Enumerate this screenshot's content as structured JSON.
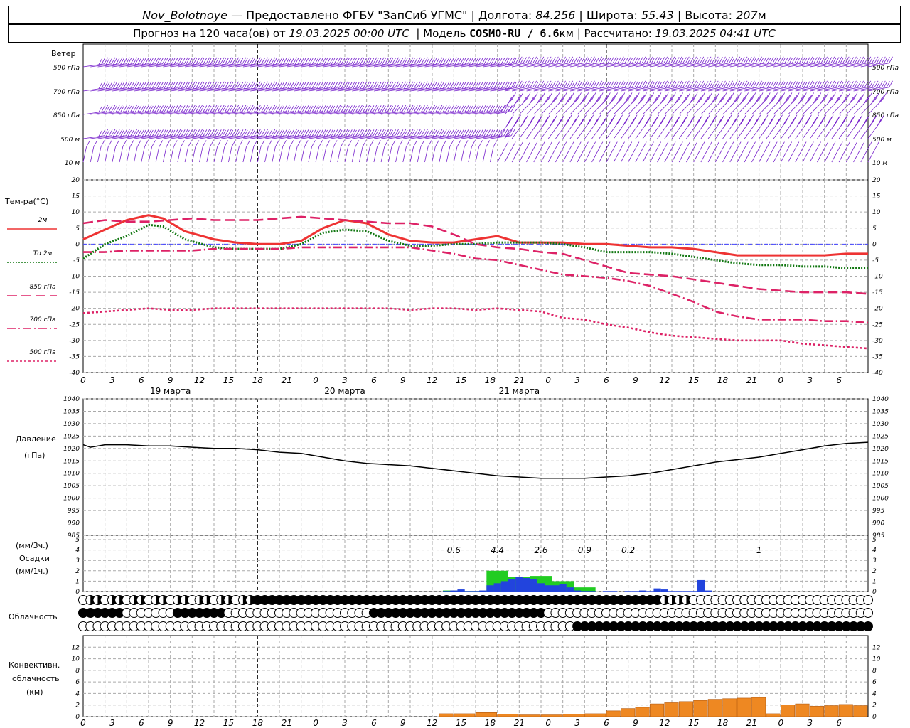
{
  "header": {
    "station": "Nov_Bolotnoye",
    "provider": "— Предоставлено ФГБУ \"ЗапСиб УГМС\" |",
    "lon_label": "Долгота:",
    "lon": "84.256",
    "lat_label": "| Широта:",
    "lat": "55.43",
    "alt_label": "| Высота:",
    "alt": "207",
    "alt_unit": "м",
    "forecast_label": "Прогноз на 120 часа(ов) от",
    "forecast_start": "19.03.2025 00:00 UTC",
    "model_label": "| Модель",
    "model": "COSMO-RU / 6.6",
    "model_unit": "км",
    "calc_label": "| Рассчитано:",
    "calc_time": "19.03.2025 04:41 UTC"
  },
  "wind_panel": {
    "title": "Ветер",
    "levels": [
      "500 гПа",
      "700 гПа",
      "850 гПа",
      "500 м",
      "10 м"
    ]
  },
  "temp_panel": {
    "title": "Тем-ра(°C)",
    "legend": [
      {
        "label": "2м",
        "color": "#ee3333",
        "dash": "solid"
      },
      {
        "label": "Td  2м",
        "color": "#117711",
        "dash": "dot"
      },
      {
        "label": "850 гПа",
        "color": "#dd2266",
        "dash": "long"
      },
      {
        "label": "700 гПа",
        "color": "#dd2266",
        "dash": "dashdot"
      },
      {
        "label": "500 гПа",
        "color": "#dd2266",
        "dash": "short"
      }
    ]
  },
  "x_axis": {
    "ticks": [
      "0",
      "3",
      "6",
      "9",
      "12",
      "15",
      "18",
      "21",
      "0",
      "3",
      "6",
      "9",
      "12",
      "15",
      "18",
      "21",
      "0",
      "3",
      "6",
      "9",
      "12",
      "15",
      "18",
      "21",
      "0",
      "3",
      "6"
    ],
    "days": [
      "19 марта",
      "20 марта",
      "21 марта"
    ]
  },
  "pressure_panel": {
    "title": "Давление",
    "unit": "(гПа)"
  },
  "precip_panel": {
    "unit_top": "(мм/3ч.)",
    "title": "Осадки",
    "unit_bottom": "(мм/1ч.)",
    "totals": [
      {
        "hour": 51,
        "text": "0.6"
      },
      {
        "hour": 57,
        "text": "4.4"
      },
      {
        "hour": 63,
        "text": "2.6"
      },
      {
        "hour": 69,
        "text": "0.9"
      },
      {
        "hour": 75,
        "text": "0.2"
      },
      {
        "hour": 93,
        "text": "1"
      }
    ]
  },
  "cloud_panel": {
    "title": "Облачность"
  },
  "conv_panel": {
    "title1": "Конвективн.",
    "title2": "облачность",
    "unit": "(км)"
  },
  "colors": {
    "wind": "#7722cc",
    "t2m": "#ee3333",
    "td2m": "#117711",
    "t_levels": "#dd2266",
    "pressure": "#000000",
    "precip_3h": "#22cc22",
    "precip_1h": "#2244dd",
    "convective": "#ee8822",
    "zero_line": "#4444ff"
  },
  "chart_data": [
    {
      "type": "line",
      "title": "Тем-ра(°C)",
      "x_unit": "hours from 19.03.2025 00:00 UTC",
      "ylim": [
        -40,
        20
      ],
      "y_ticks": [
        -40,
        -35,
        -30,
        -25,
        -20,
        -15,
        -10,
        -5,
        0,
        5,
        10,
        15,
        20
      ],
      "grid": true,
      "series": [
        {
          "name": "2м",
          "x": [
            0,
            3,
            6,
            9,
            11,
            14,
            18,
            21,
            24,
            27,
            30,
            33,
            36,
            39,
            42,
            45,
            48,
            51,
            54,
            57,
            60,
            63,
            66,
            69,
            72,
            75,
            78,
            81,
            84,
            87,
            90,
            93,
            96,
            99,
            102,
            105,
            108
          ],
          "values": [
            1.5,
            4.5,
            7.5,
            9,
            8,
            4,
            1.5,
            0.5,
            0,
            0,
            1,
            5,
            7.5,
            6.5,
            3,
            1,
            0.5,
            0.5,
            1.5,
            2.5,
            0.5,
            0.5,
            0.5,
            0,
            0,
            -0.5,
            -1,
            -1,
            -1.5,
            -2.5,
            -3.5,
            -3.5,
            -3.5,
            -3.5,
            -3.5,
            -3,
            -3
          ]
        },
        {
          "name": "Td  2м",
          "x": [
            0,
            3,
            6,
            9,
            11,
            14,
            18,
            21,
            24,
            27,
            30,
            33,
            36,
            39,
            42,
            45,
            48,
            51,
            54,
            57,
            60,
            63,
            66,
            69,
            72,
            75,
            78,
            81,
            84,
            87,
            90,
            93,
            96,
            99,
            102,
            105,
            108
          ],
          "values": [
            -4.5,
            0,
            2.5,
            6,
            5.5,
            1.5,
            -1,
            -1.5,
            -1.5,
            -1.5,
            0,
            3.5,
            4.5,
            4,
            1,
            -0.5,
            -0.5,
            0,
            0,
            0.5,
            0.5,
            0.5,
            0,
            -1,
            -2.5,
            -2.5,
            -2.5,
            -3,
            -4,
            -5,
            -6,
            -6.5,
            -6.5,
            -7,
            -7,
            -7.5,
            -7.5
          ]
        },
        {
          "name": "850 гПа",
          "x": [
            0,
            3,
            6,
            9,
            12,
            15,
            18,
            21,
            24,
            27,
            30,
            33,
            36,
            39,
            42,
            45,
            48,
            51,
            54,
            57,
            60,
            63,
            66,
            69,
            72,
            75,
            78,
            81,
            84,
            87,
            90,
            93,
            96,
            99,
            102,
            105,
            108
          ],
          "values": [
            6.5,
            7.5,
            7,
            7,
            7.5,
            8,
            7.5,
            7.5,
            7.5,
            8,
            8.5,
            8,
            7.5,
            7,
            6.5,
            6.5,
            5.5,
            3,
            0,
            -1,
            -1.5,
            -2.5,
            -3,
            -5,
            -7,
            -9,
            -9.5,
            -10,
            -11,
            -12,
            -13,
            -14,
            -14.5,
            -15,
            -15,
            -15,
            -15.5
          ]
        },
        {
          "name": "700 гПа",
          "x": [
            0,
            3,
            6,
            9,
            12,
            15,
            18,
            21,
            24,
            27,
            30,
            33,
            36,
            39,
            42,
            45,
            48,
            51,
            54,
            57,
            60,
            63,
            66,
            69,
            72,
            75,
            78,
            81,
            84,
            87,
            90,
            93,
            96,
            99,
            102,
            105,
            108
          ],
          "values": [
            -2.5,
            -2.5,
            -2,
            -2,
            -2,
            -2,
            -1.5,
            -1.5,
            -1.5,
            -1.5,
            -1,
            -1,
            -1,
            -1,
            -1,
            -1,
            -2,
            -3,
            -4.5,
            -5,
            -6.5,
            -8,
            -9.5,
            -10,
            -10.5,
            -11.5,
            -13,
            -15.5,
            -18,
            -21,
            -22.5,
            -23.5,
            -23.5,
            -23.5,
            -24,
            -24,
            -24.5
          ]
        },
        {
          "name": "500 гПа",
          "x": [
            0,
            3,
            6,
            9,
            12,
            15,
            18,
            21,
            24,
            27,
            30,
            33,
            36,
            39,
            42,
            45,
            48,
            51,
            54,
            57,
            60,
            63,
            66,
            69,
            72,
            75,
            78,
            81,
            84,
            87,
            90,
            93,
            96,
            99,
            102,
            105,
            108
          ],
          "values": [
            -21.5,
            -21,
            -20.5,
            -20,
            -20.5,
            -20.5,
            -20,
            -20,
            -20,
            -20,
            -20,
            -20,
            -20,
            -20,
            -20,
            -20.5,
            -20,
            -20,
            -20.5,
            -20,
            -20.5,
            -21,
            -23,
            -23.5,
            -25,
            -26,
            -27.5,
            -28.5,
            -29,
            -29.5,
            -30,
            -30,
            -30,
            -31,
            -31.5,
            -32,
            -32.5
          ]
        }
      ]
    },
    {
      "type": "line",
      "title": "Давление",
      "ylabel": "(гПа)",
      "ylim": [
        985,
        1040
      ],
      "y_ticks": [
        985,
        990,
        995,
        1000,
        1005,
        1010,
        1015,
        1020,
        1025,
        1030,
        1035,
        1040
      ],
      "series": [
        {
          "name": "",
          "x": [
            0,
            1,
            3,
            6,
            9,
            12,
            15,
            18,
            21,
            24,
            27,
            30,
            33,
            36,
            39,
            42,
            45,
            48,
            51,
            54,
            57,
            60,
            63,
            66,
            69,
            72,
            75,
            78,
            81,
            84,
            87,
            90,
            93,
            96,
            99,
            102,
            105,
            108
          ],
          "values": [
            1021.5,
            1020.5,
            1021.5,
            1021.5,
            1021,
            1021,
            1020.5,
            1020,
            1020,
            1019.5,
            1018.5,
            1018,
            1016.5,
            1015,
            1014,
            1013.5,
            1013,
            1012,
            1011,
            1010,
            1009,
            1008.5,
            1008,
            1008,
            1008,
            1008.5,
            1009,
            1010,
            1011.5,
            1013,
            1014.5,
            1015.5,
            1016.5,
            1018,
            1019.5,
            1021,
            1022,
            1022.5
          ]
        }
      ]
    },
    {
      "type": "bar",
      "title": "Осадки",
      "ylabel": "(мм/3ч.) (мм/1ч.)",
      "ylim": [
        0,
        5
      ],
      "y_ticks": [
        0,
        1,
        2,
        3,
        4,
        5
      ],
      "series": [
        {
          "name": "мм/3ч.",
          "x": [
            51,
            54,
            57,
            60,
            63,
            66,
            69
          ],
          "values": [
            0.1,
            0.05,
            2,
            1.4,
            1.5,
            1.0,
            0.4
          ]
        },
        {
          "name": "мм/1ч.",
          "x": [
            50,
            51,
            52,
            53,
            54,
            55,
            56,
            57,
            58,
            59,
            60,
            61,
            62,
            63,
            64,
            65,
            66,
            67,
            68,
            69,
            70,
            72,
            73,
            75,
            76,
            77,
            78,
            79,
            80,
            81,
            82,
            83,
            84,
            85,
            86
          ],
          "values": [
            0.05,
            0.1,
            0.2,
            0.05,
            0.05,
            0.1,
            0.6,
            0.8,
            1.0,
            1.2,
            1.4,
            1.3,
            1.2,
            0.8,
            0.6,
            0.6,
            0.7,
            0.4,
            0.1,
            0.05,
            0.05,
            0.05,
            0.05,
            0.05,
            0.05,
            0.1,
            0.05,
            0.3,
            0.2,
            0.05,
            0.05,
            0.05,
            0.05,
            1.1,
            0.1
          ]
        }
      ]
    },
    {
      "type": "area",
      "title": "Конвективн. облачность",
      "ylabel": "(км)",
      "ylim": [
        0,
        14
      ],
      "y_ticks": [
        0,
        2,
        4,
        6,
        8,
        10,
        12
      ],
      "series": [
        {
          "name": "",
          "x": [
            49,
            51,
            54,
            57,
            60,
            63,
            66,
            69,
            72,
            74,
            76,
            78,
            80,
            82,
            84,
            86,
            88,
            90,
            92,
            94,
            96,
            98,
            100,
            102,
            104,
            106,
            108
          ],
          "values": [
            0.5,
            0.5,
            0.7,
            0.4,
            0.3,
            0.3,
            0.4,
            0.5,
            1,
            1.4,
            1.6,
            2.2,
            2.4,
            2.6,
            2.8,
            3.0,
            3.1,
            3.2,
            3.3,
            0.5,
            2.0,
            2.2,
            1.8,
            1.9,
            2.1,
            1.9,
            2.2
          ]
        }
      ]
    }
  ]
}
